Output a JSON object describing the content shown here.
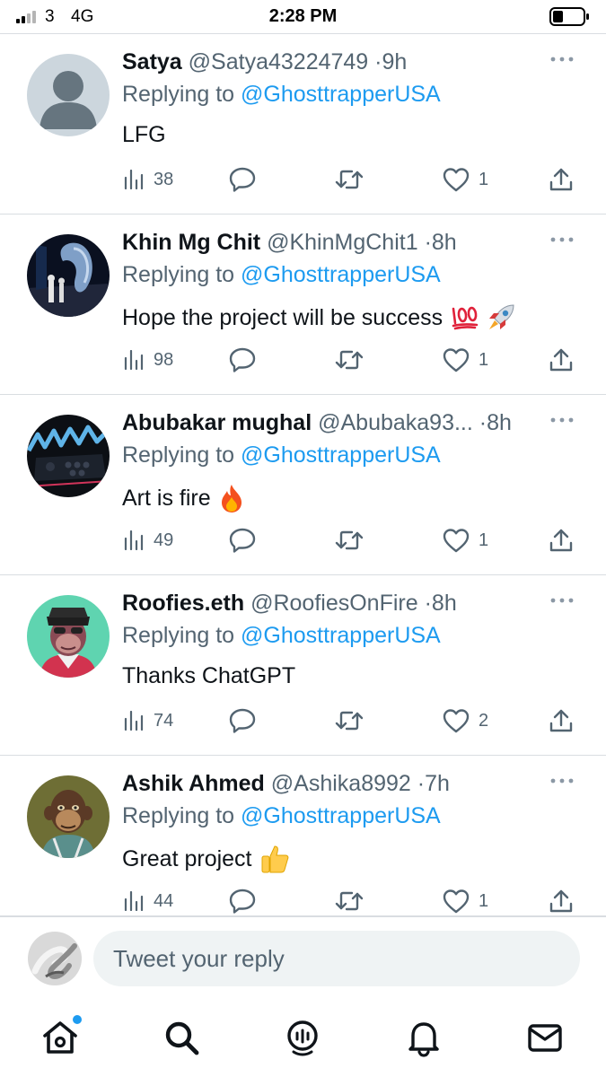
{
  "status_bar": {
    "carrier": "3",
    "network": "4G",
    "time": "2:28 PM"
  },
  "colors": {
    "accent": "#1d9bf0",
    "secondary_text": "#536471",
    "divider": "#d9dde1"
  },
  "tweets": [
    {
      "name": "Satya",
      "handle": "@Satya43224749",
      "sep": "·",
      "time": "9h",
      "replying_prefix": "Replying to ",
      "replying_to": "@GhosttrapperUSA",
      "text": "LFG",
      "emoji": [],
      "views": "38",
      "likes": "1",
      "avatar": "default-avatar"
    },
    {
      "name": "Khin Mg Chit",
      "handle": "@KhinMgChit1",
      "sep": "·",
      "time": "8h",
      "replying_prefix": "Replying to ",
      "replying_to": "@GhosttrapperUSA",
      "text": "Hope the project will be success",
      "emoji": [
        "hundred-points-emoji",
        "rocket-emoji"
      ],
      "views": "98",
      "likes": "1",
      "avatar": "nft-art-avatar"
    },
    {
      "name": "Abubakar mughal",
      "handle": "@Abubaka93...",
      "sep": "·",
      "time": "8h",
      "replying_prefix": "Replying to ",
      "replying_to": "@GhosttrapperUSA",
      "text": "Art is fire",
      "emoji": [
        "fire-emoji"
      ],
      "views": "49",
      "likes": "1",
      "avatar": "arcade-avatar"
    },
    {
      "name": "Roofies.eth",
      "handle": "@RoofiesOnFire",
      "sep": "·",
      "time": "8h",
      "replying_prefix": "Replying to ",
      "replying_to": "@GhosttrapperUSA",
      "text": "Thanks ChatGPT",
      "emoji": [],
      "views": "74",
      "likes": "2",
      "avatar": "ape-avatar-mint"
    },
    {
      "name": "Ashik Ahmed",
      "handle": "@Ashika8992",
      "sep": "·",
      "time": "7h",
      "replying_prefix": "Replying to ",
      "replying_to": "@GhosttrapperUSA",
      "text": "Great project",
      "emoji": [
        "thumbs-up-emoji"
      ],
      "views": "44",
      "likes": "1",
      "avatar": "ape-avatar-olive"
    }
  ],
  "reply_bar": {
    "placeholder": "Tweet your reply"
  },
  "tab_bar": {
    "items": [
      "home-icon",
      "search-icon",
      "spaces-icon",
      "notifications-icon",
      "messages-icon"
    ]
  }
}
